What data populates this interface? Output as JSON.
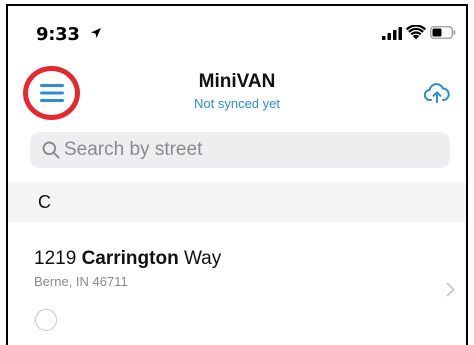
{
  "status_bar": {
    "time": "9:33"
  },
  "nav": {
    "title": "MiniVAN",
    "subtitle": "Not synced yet"
  },
  "search": {
    "placeholder": "Search by street",
    "value": ""
  },
  "section": {
    "letter": "C"
  },
  "list": {
    "items": [
      {
        "number": "1219",
        "street_bold": "Carrington",
        "street_suffix": "Way",
        "city": "Berne, IN 46711"
      }
    ]
  },
  "colors": {
    "accent": "#2a8fd6",
    "highlight_circle": "#e8262f"
  },
  "icons": {
    "menu": "hamburger-menu-icon",
    "sync": "cloud-upload-icon",
    "search": "magnifier-icon",
    "chevron": "chevron-right-icon"
  }
}
